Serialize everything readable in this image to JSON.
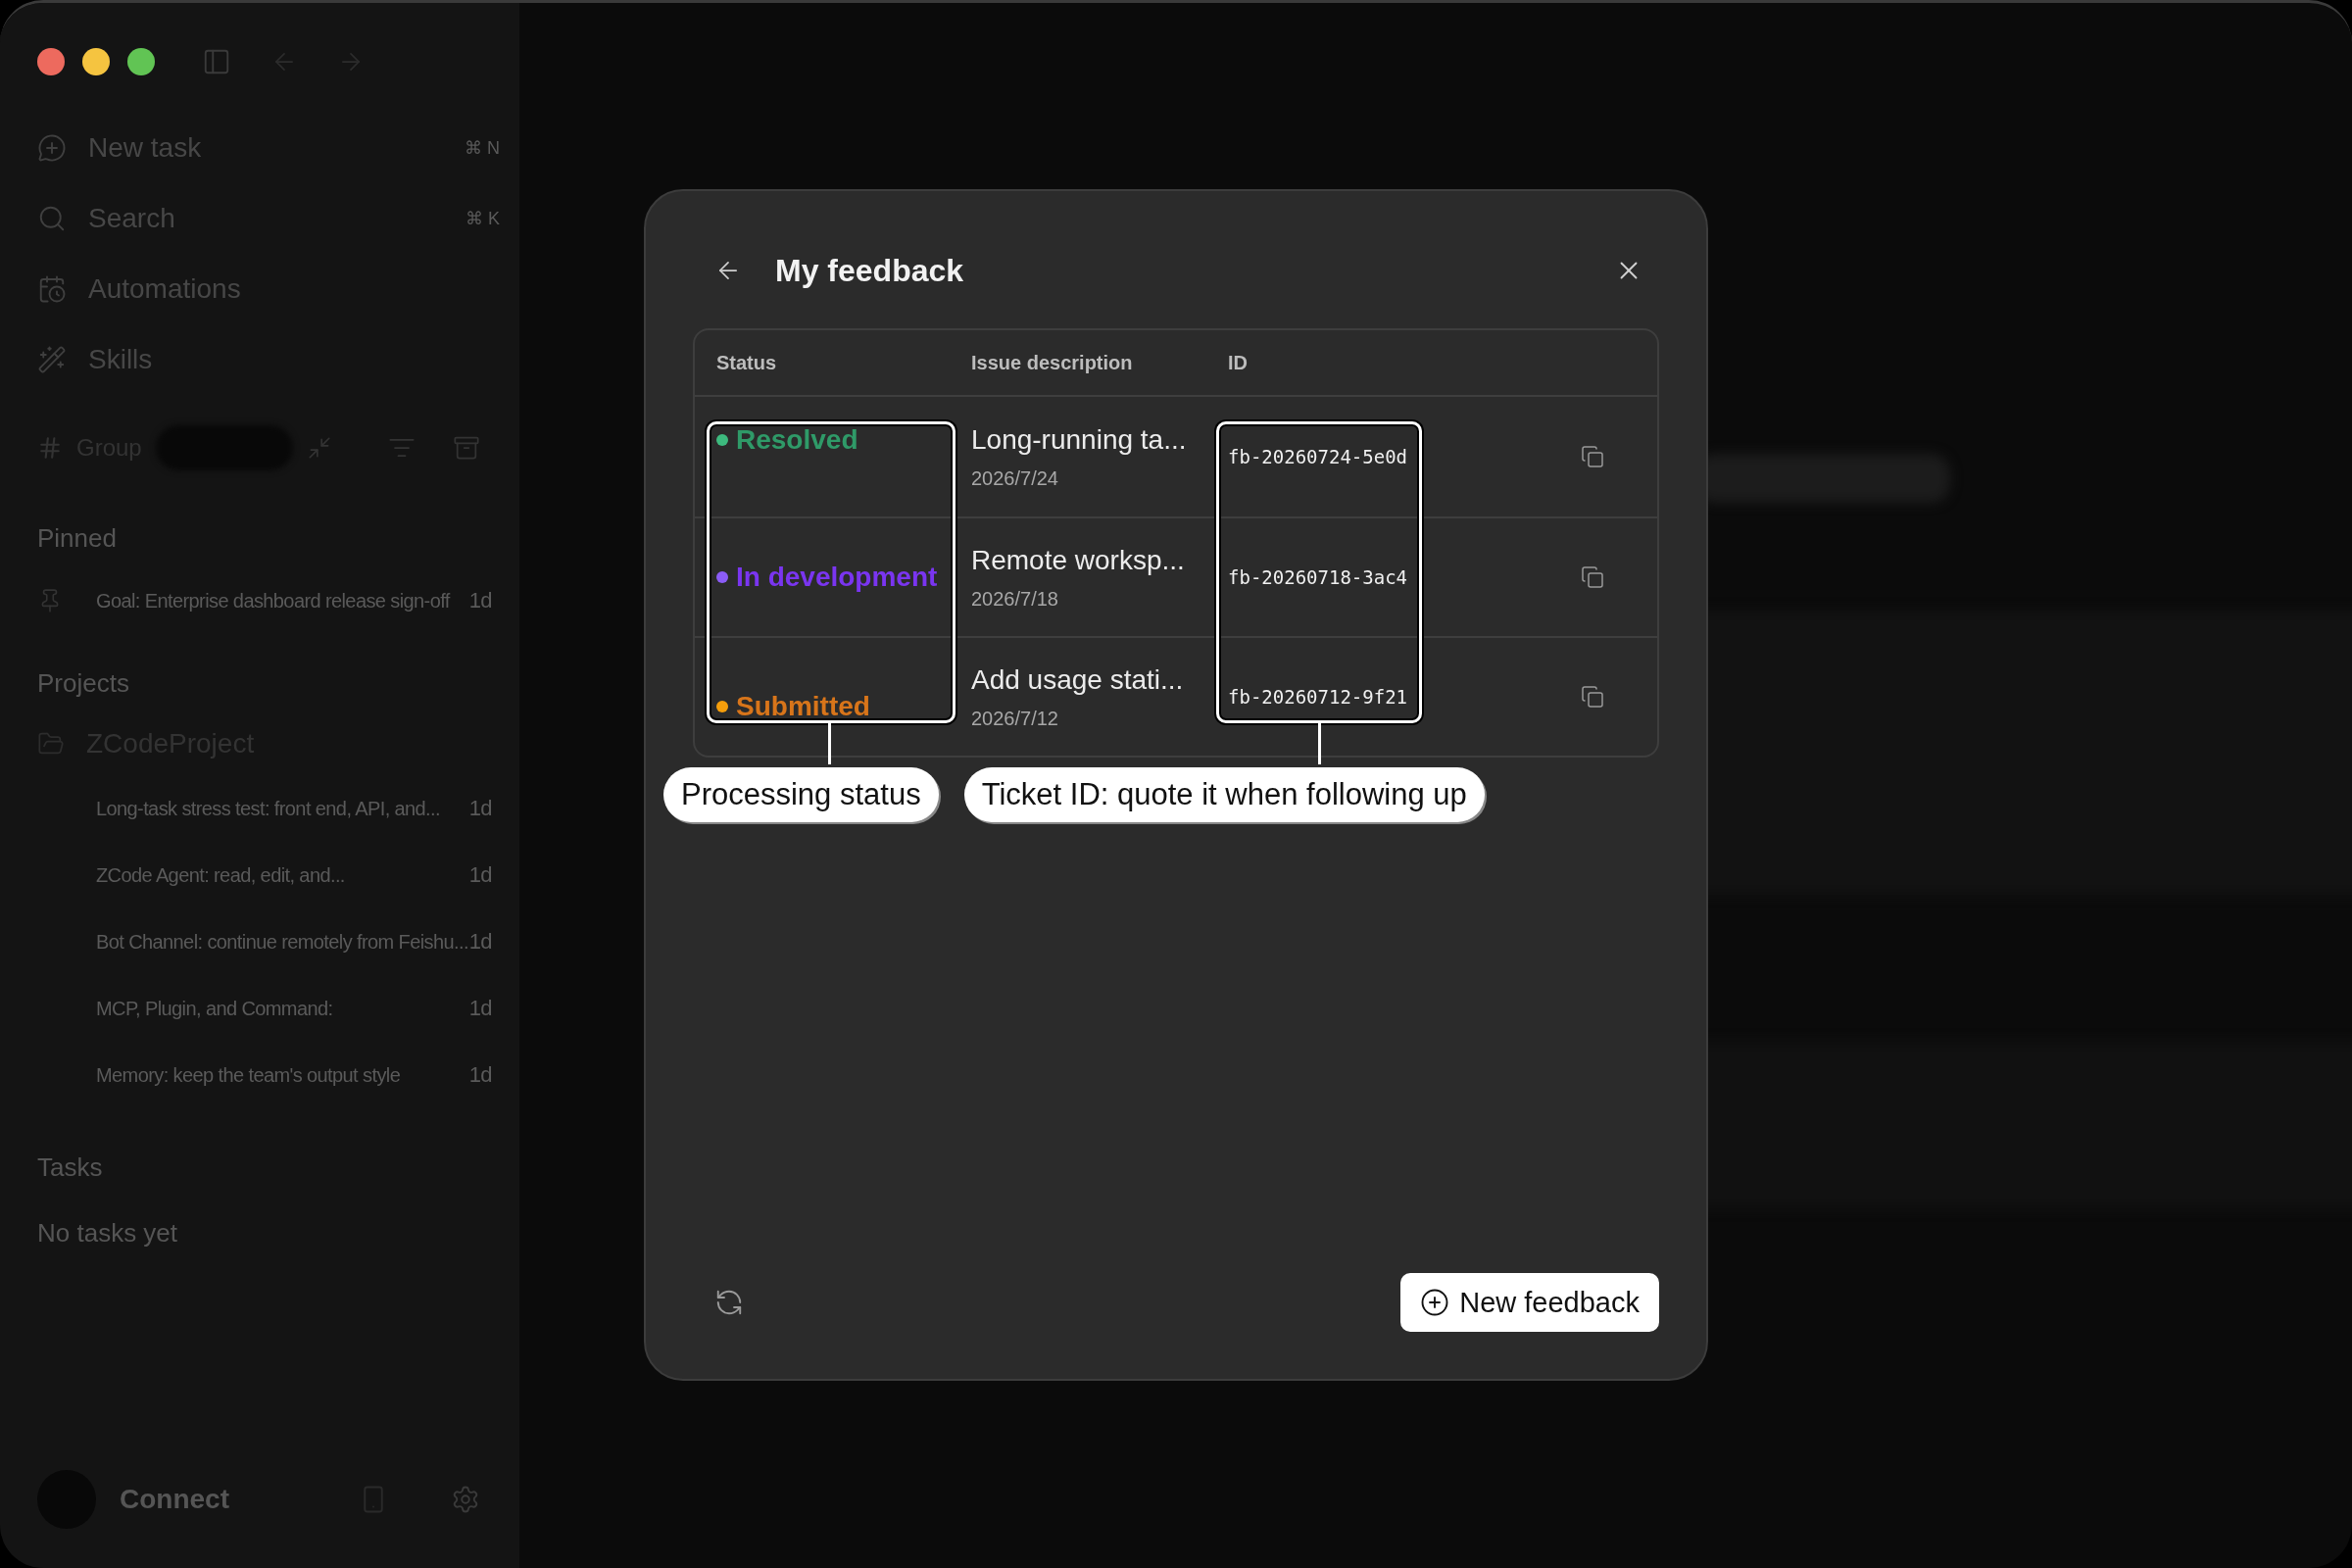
{
  "sidebar": {
    "nav": [
      {
        "kind": "new",
        "label": "New task",
        "shortcut": "⌘ N"
      },
      {
        "kind": "search",
        "label": "Search",
        "shortcut": "⌘ K"
      },
      {
        "kind": "automations",
        "label": "Automations"
      },
      {
        "kind": "skills",
        "label": "Skills"
      }
    ],
    "group_label": "Group",
    "pinned_heading": "Pinned",
    "pinned": [
      {
        "title": "Goal: Enterprise dashboard release sign-off",
        "age": "1d"
      }
    ],
    "projects_heading": "Projects",
    "project": {
      "name": "ZCodeProject",
      "items": [
        {
          "title": "Long-task stress test: front end, API, and...",
          "age": "1d"
        },
        {
          "title": "ZCode Agent: read, edit, and...",
          "age": "1d"
        },
        {
          "title": "Bot Channel: continue remotely from Feishu...",
          "age": "1d"
        },
        {
          "title": "MCP, Plugin, and Command:",
          "age": "1d"
        },
        {
          "title": "Memory: keep the team's output style",
          "age": "1d"
        }
      ]
    },
    "tasks_heading": "Tasks",
    "tasks_empty": "No tasks yet",
    "connect": "Connect"
  },
  "dialog": {
    "title": "My feedback",
    "columns": [
      "Status",
      "Issue description",
      "ID"
    ],
    "rows": [
      {
        "status": "Resolved",
        "kind": "resolved",
        "color": "#3dba7e",
        "description": "Long-running ta...",
        "date": "2026/7/24",
        "id": "fb-20260724-5e0d"
      },
      {
        "status": "In development",
        "kind": "development",
        "color": "#8b5cf6",
        "description": "Remote worksp...",
        "date": "2026/7/18",
        "id": "fb-20260718-3ac4"
      },
      {
        "status": "Submitted",
        "kind": "submitted",
        "color": "#f59e0b",
        "description": "Add usage stati...",
        "date": "2026/7/12",
        "id": "fb-20260712-9f21"
      }
    ],
    "annotations": [
      {
        "text": "Processing status"
      },
      {
        "text": "Ticket ID: quote it when following up"
      }
    ],
    "new_button": "New feedback"
  }
}
